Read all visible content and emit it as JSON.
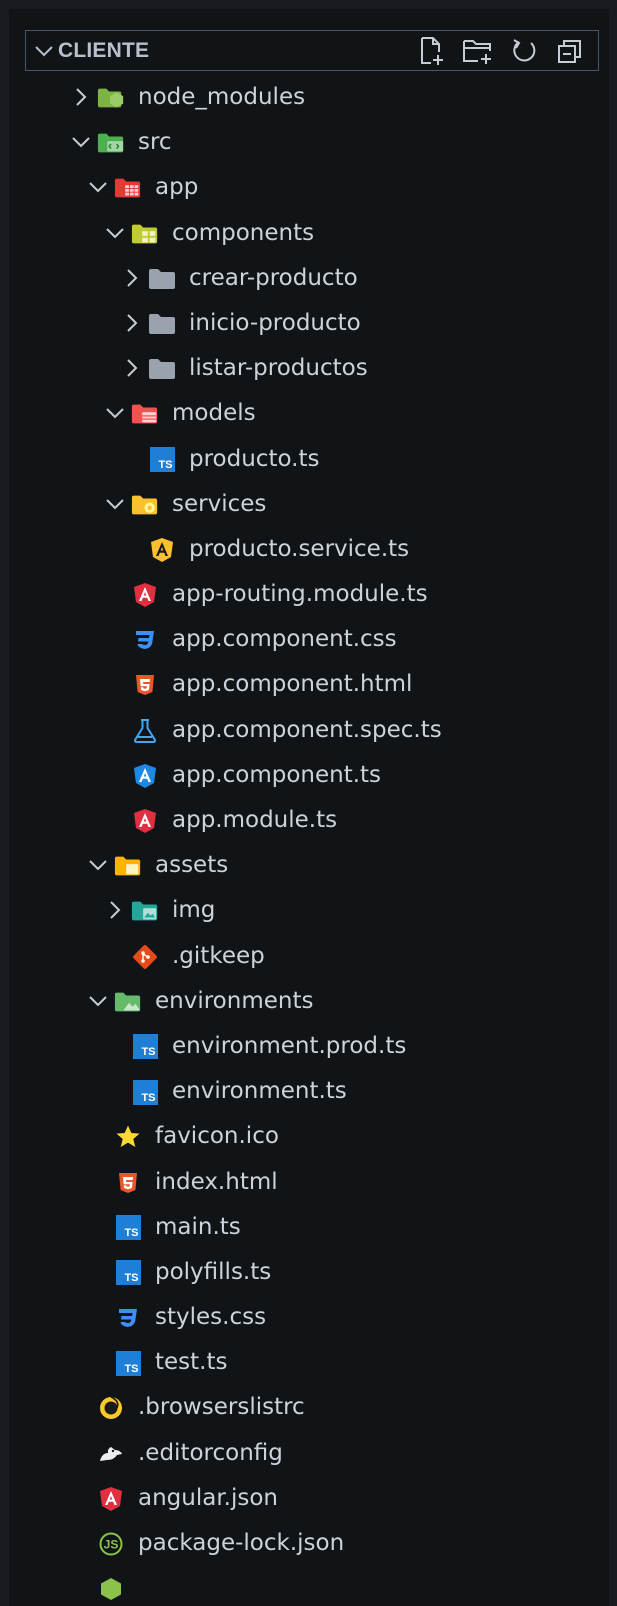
{
  "explorer": {
    "title": "CLIENTE",
    "actions": [
      {
        "name": "new-file-icon"
      },
      {
        "name": "new-folder-icon"
      },
      {
        "name": "refresh-icon"
      },
      {
        "name": "collapse-all-icon"
      }
    ]
  },
  "tree": [
    {
      "label": "node_modules",
      "depth": 0,
      "type": "folder",
      "expanded": false,
      "icon": "folder-node-icon"
    },
    {
      "label": "src",
      "depth": 0,
      "type": "folder",
      "expanded": true,
      "icon": "folder-src-icon"
    },
    {
      "label": "app",
      "depth": 1,
      "type": "folder",
      "expanded": true,
      "icon": "folder-app-icon"
    },
    {
      "label": "components",
      "depth": 2,
      "type": "folder",
      "expanded": true,
      "icon": "folder-components-icon"
    },
    {
      "label": "crear-producto",
      "depth": 3,
      "type": "folder",
      "expanded": false,
      "icon": "folder-icon"
    },
    {
      "label": "inicio-producto",
      "depth": 3,
      "type": "folder",
      "expanded": false,
      "icon": "folder-icon"
    },
    {
      "label": "listar-productos",
      "depth": 3,
      "type": "folder",
      "expanded": false,
      "icon": "folder-icon"
    },
    {
      "label": "models",
      "depth": 2,
      "type": "folder",
      "expanded": true,
      "icon": "folder-models-icon"
    },
    {
      "label": "producto.ts",
      "depth": 3,
      "type": "file",
      "icon": "typescript-icon"
    },
    {
      "label": "services",
      "depth": 2,
      "type": "folder",
      "expanded": true,
      "icon": "folder-services-icon"
    },
    {
      "label": "producto.service.ts",
      "depth": 3,
      "type": "file",
      "icon": "angular-service-icon"
    },
    {
      "label": "app-routing.module.ts",
      "depth": 2,
      "type": "file",
      "icon": "angular-icon"
    },
    {
      "label": "app.component.css",
      "depth": 2,
      "type": "file",
      "icon": "css-icon"
    },
    {
      "label": "app.component.html",
      "depth": 2,
      "type": "file",
      "icon": "html-icon"
    },
    {
      "label": "app.component.spec.ts",
      "depth": 2,
      "type": "file",
      "icon": "test-flask-icon"
    },
    {
      "label": "app.component.ts",
      "depth": 2,
      "type": "file",
      "icon": "angular-component-icon"
    },
    {
      "label": "app.module.ts",
      "depth": 2,
      "type": "file",
      "icon": "angular-icon"
    },
    {
      "label": "assets",
      "depth": 1,
      "type": "folder",
      "expanded": true,
      "icon": "folder-assets-icon"
    },
    {
      "label": "img",
      "depth": 2,
      "type": "folder",
      "expanded": false,
      "icon": "folder-images-icon"
    },
    {
      "label": ".gitkeep",
      "depth": 2,
      "type": "file",
      "icon": "git-icon"
    },
    {
      "label": "environments",
      "depth": 1,
      "type": "folder",
      "expanded": true,
      "icon": "folder-environments-icon"
    },
    {
      "label": "environment.prod.ts",
      "depth": 2,
      "type": "file",
      "icon": "typescript-icon"
    },
    {
      "label": "environment.ts",
      "depth": 2,
      "type": "file",
      "icon": "typescript-icon"
    },
    {
      "label": "favicon.ico",
      "depth": 1,
      "type": "file",
      "icon": "star-icon"
    },
    {
      "label": "index.html",
      "depth": 1,
      "type": "file",
      "icon": "html-icon"
    },
    {
      "label": "main.ts",
      "depth": 1,
      "type": "file",
      "icon": "typescript-icon"
    },
    {
      "label": "polyfills.ts",
      "depth": 1,
      "type": "file",
      "icon": "typescript-icon"
    },
    {
      "label": "styles.css",
      "depth": 1,
      "type": "file",
      "icon": "css-icon"
    },
    {
      "label": "test.ts",
      "depth": 1,
      "type": "file",
      "icon": "typescript-icon"
    },
    {
      "label": ".browserslistrc",
      "depth": 0,
      "type": "file",
      "icon": "browserslist-icon"
    },
    {
      "label": ".editorconfig",
      "depth": 0,
      "type": "file",
      "icon": "editorconfig-icon"
    },
    {
      "label": "angular.json",
      "depth": 0,
      "type": "file",
      "icon": "angular-icon"
    },
    {
      "label": "package-lock.json",
      "depth": 0,
      "type": "file",
      "icon": "npm-icon"
    },
    {
      "label": "",
      "depth": 0,
      "type": "file",
      "icon": "nodejs-icon"
    }
  ],
  "colors": {
    "background": "#111417",
    "text": "#cdd3da",
    "header_border": "#4a5566",
    "typescript": "#1f7fd6",
    "angular": "#e0303f",
    "css": "#3f8ef5",
    "html": "#e8572a"
  }
}
